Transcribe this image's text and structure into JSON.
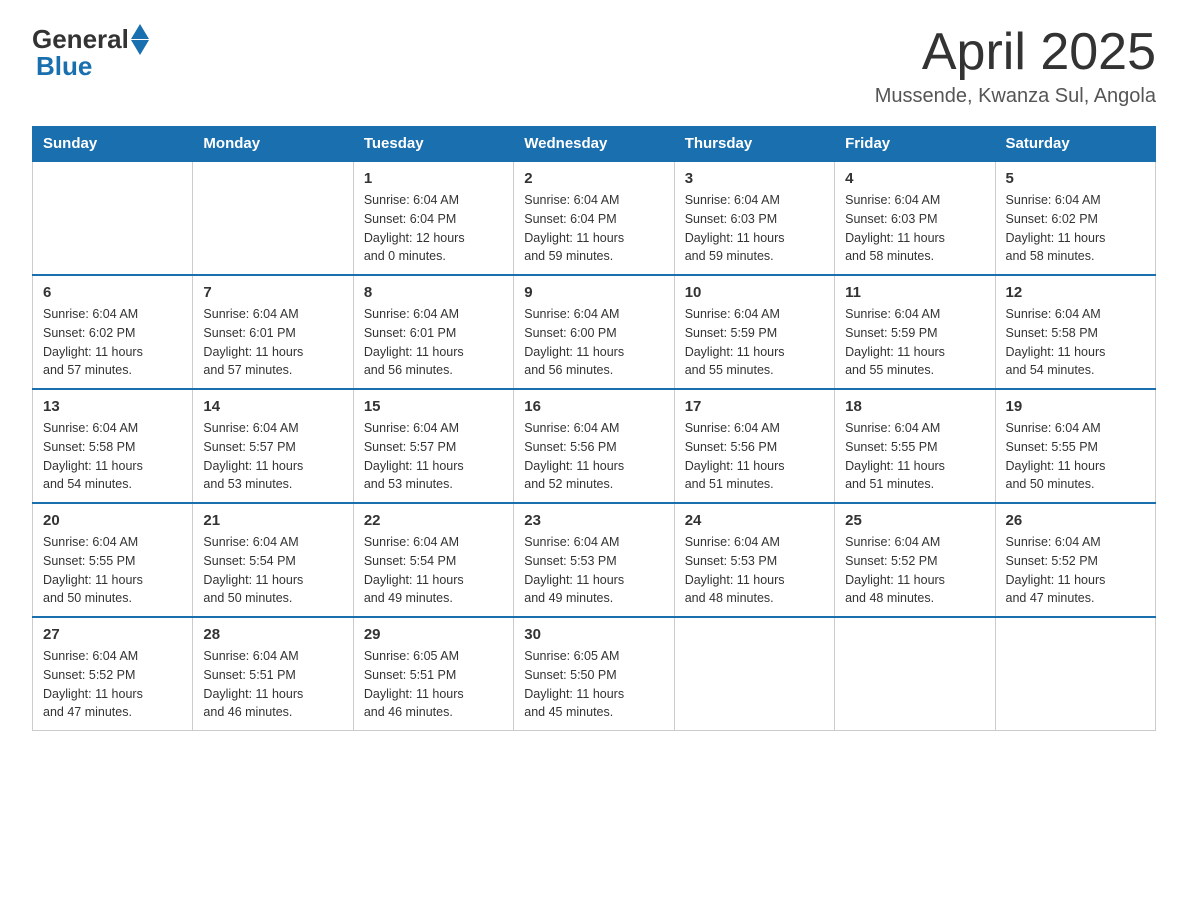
{
  "header": {
    "logo_general": "General",
    "logo_blue": "Blue",
    "title": "April 2025",
    "subtitle": "Mussende, Kwanza Sul, Angola"
  },
  "days_of_week": [
    "Sunday",
    "Monday",
    "Tuesday",
    "Wednesday",
    "Thursday",
    "Friday",
    "Saturday"
  ],
  "weeks": [
    [
      {
        "day": "",
        "detail": ""
      },
      {
        "day": "",
        "detail": ""
      },
      {
        "day": "1",
        "detail": "Sunrise: 6:04 AM\nSunset: 6:04 PM\nDaylight: 12 hours\nand 0 minutes."
      },
      {
        "day": "2",
        "detail": "Sunrise: 6:04 AM\nSunset: 6:04 PM\nDaylight: 11 hours\nand 59 minutes."
      },
      {
        "day": "3",
        "detail": "Sunrise: 6:04 AM\nSunset: 6:03 PM\nDaylight: 11 hours\nand 59 minutes."
      },
      {
        "day": "4",
        "detail": "Sunrise: 6:04 AM\nSunset: 6:03 PM\nDaylight: 11 hours\nand 58 minutes."
      },
      {
        "day": "5",
        "detail": "Sunrise: 6:04 AM\nSunset: 6:02 PM\nDaylight: 11 hours\nand 58 minutes."
      }
    ],
    [
      {
        "day": "6",
        "detail": "Sunrise: 6:04 AM\nSunset: 6:02 PM\nDaylight: 11 hours\nand 57 minutes."
      },
      {
        "day": "7",
        "detail": "Sunrise: 6:04 AM\nSunset: 6:01 PM\nDaylight: 11 hours\nand 57 minutes."
      },
      {
        "day": "8",
        "detail": "Sunrise: 6:04 AM\nSunset: 6:01 PM\nDaylight: 11 hours\nand 56 minutes."
      },
      {
        "day": "9",
        "detail": "Sunrise: 6:04 AM\nSunset: 6:00 PM\nDaylight: 11 hours\nand 56 minutes."
      },
      {
        "day": "10",
        "detail": "Sunrise: 6:04 AM\nSunset: 5:59 PM\nDaylight: 11 hours\nand 55 minutes."
      },
      {
        "day": "11",
        "detail": "Sunrise: 6:04 AM\nSunset: 5:59 PM\nDaylight: 11 hours\nand 55 minutes."
      },
      {
        "day": "12",
        "detail": "Sunrise: 6:04 AM\nSunset: 5:58 PM\nDaylight: 11 hours\nand 54 minutes."
      }
    ],
    [
      {
        "day": "13",
        "detail": "Sunrise: 6:04 AM\nSunset: 5:58 PM\nDaylight: 11 hours\nand 54 minutes."
      },
      {
        "day": "14",
        "detail": "Sunrise: 6:04 AM\nSunset: 5:57 PM\nDaylight: 11 hours\nand 53 minutes."
      },
      {
        "day": "15",
        "detail": "Sunrise: 6:04 AM\nSunset: 5:57 PM\nDaylight: 11 hours\nand 53 minutes."
      },
      {
        "day": "16",
        "detail": "Sunrise: 6:04 AM\nSunset: 5:56 PM\nDaylight: 11 hours\nand 52 minutes."
      },
      {
        "day": "17",
        "detail": "Sunrise: 6:04 AM\nSunset: 5:56 PM\nDaylight: 11 hours\nand 51 minutes."
      },
      {
        "day": "18",
        "detail": "Sunrise: 6:04 AM\nSunset: 5:55 PM\nDaylight: 11 hours\nand 51 minutes."
      },
      {
        "day": "19",
        "detail": "Sunrise: 6:04 AM\nSunset: 5:55 PM\nDaylight: 11 hours\nand 50 minutes."
      }
    ],
    [
      {
        "day": "20",
        "detail": "Sunrise: 6:04 AM\nSunset: 5:55 PM\nDaylight: 11 hours\nand 50 minutes."
      },
      {
        "day": "21",
        "detail": "Sunrise: 6:04 AM\nSunset: 5:54 PM\nDaylight: 11 hours\nand 50 minutes."
      },
      {
        "day": "22",
        "detail": "Sunrise: 6:04 AM\nSunset: 5:54 PM\nDaylight: 11 hours\nand 49 minutes."
      },
      {
        "day": "23",
        "detail": "Sunrise: 6:04 AM\nSunset: 5:53 PM\nDaylight: 11 hours\nand 49 minutes."
      },
      {
        "day": "24",
        "detail": "Sunrise: 6:04 AM\nSunset: 5:53 PM\nDaylight: 11 hours\nand 48 minutes."
      },
      {
        "day": "25",
        "detail": "Sunrise: 6:04 AM\nSunset: 5:52 PM\nDaylight: 11 hours\nand 48 minutes."
      },
      {
        "day": "26",
        "detail": "Sunrise: 6:04 AM\nSunset: 5:52 PM\nDaylight: 11 hours\nand 47 minutes."
      }
    ],
    [
      {
        "day": "27",
        "detail": "Sunrise: 6:04 AM\nSunset: 5:52 PM\nDaylight: 11 hours\nand 47 minutes."
      },
      {
        "day": "28",
        "detail": "Sunrise: 6:04 AM\nSunset: 5:51 PM\nDaylight: 11 hours\nand 46 minutes."
      },
      {
        "day": "29",
        "detail": "Sunrise: 6:05 AM\nSunset: 5:51 PM\nDaylight: 11 hours\nand 46 minutes."
      },
      {
        "day": "30",
        "detail": "Sunrise: 6:05 AM\nSunset: 5:50 PM\nDaylight: 11 hours\nand 45 minutes."
      },
      {
        "day": "",
        "detail": ""
      },
      {
        "day": "",
        "detail": ""
      },
      {
        "day": "",
        "detail": ""
      }
    ]
  ]
}
